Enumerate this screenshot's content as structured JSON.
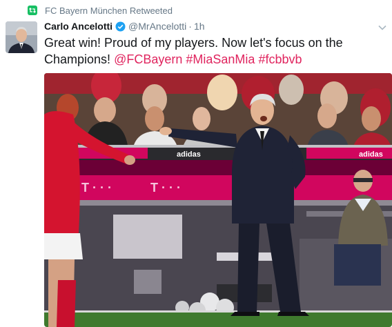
{
  "retweet": {
    "icon": "retweet-icon",
    "label": "FC Bayern München Retweeted"
  },
  "tweet": {
    "author_name": "Carlo Ancelotti",
    "verified_icon": "verified-badge-icon",
    "handle": "@MrAncelotti",
    "separator": "·",
    "timestamp": "1h",
    "menu_icon": "chevron-down-icon",
    "text_plain": "Great win! Proud of my players. Now let's focus on the Champions! ",
    "mention": "@FCBayern",
    "hashtag_1": "#MiaSanMia",
    "hashtag_2": "#fcbbvb"
  },
  "media": {
    "banner_1": "T · · ·",
    "banner_2": "T · · ·",
    "sponsor_1": "adidas",
    "sponsor_2": "adidas"
  },
  "colors": {
    "link": "#e0245e",
    "retweet_green": "#17bf63",
    "verified_blue": "#1da1f2",
    "secondary_text": "#657786"
  }
}
